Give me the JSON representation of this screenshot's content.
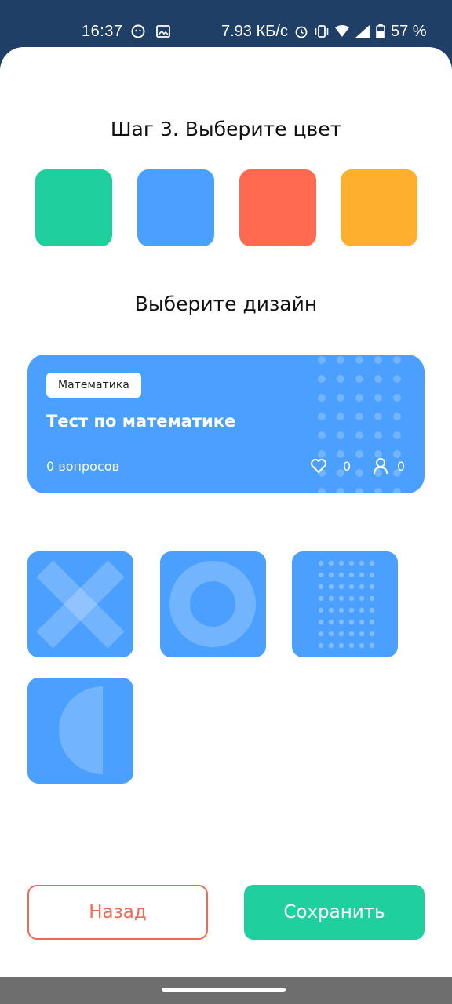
{
  "status_bar": {
    "time": "16:37",
    "speed": "7.93 КБ/с",
    "battery": "57 %"
  },
  "step": {
    "title": "Шаг 3. Выберите цвет"
  },
  "colors": {
    "green": "#1fcf9d",
    "blue": "#4b9ffe",
    "red": "#ff6a50",
    "orange": "#ffaf2e",
    "selected": "blue"
  },
  "design": {
    "title": "Выберите дизайн",
    "options": [
      "cross-pattern",
      "circle-pattern",
      "dots-pattern",
      "half-circle-pattern"
    ]
  },
  "preview": {
    "tag": "Математика",
    "title": "Тест по математике",
    "questions": "0 вопросов",
    "likes": "0",
    "users": "0"
  },
  "buttons": {
    "back_label": "Назад",
    "save_label": "Сохранить"
  }
}
